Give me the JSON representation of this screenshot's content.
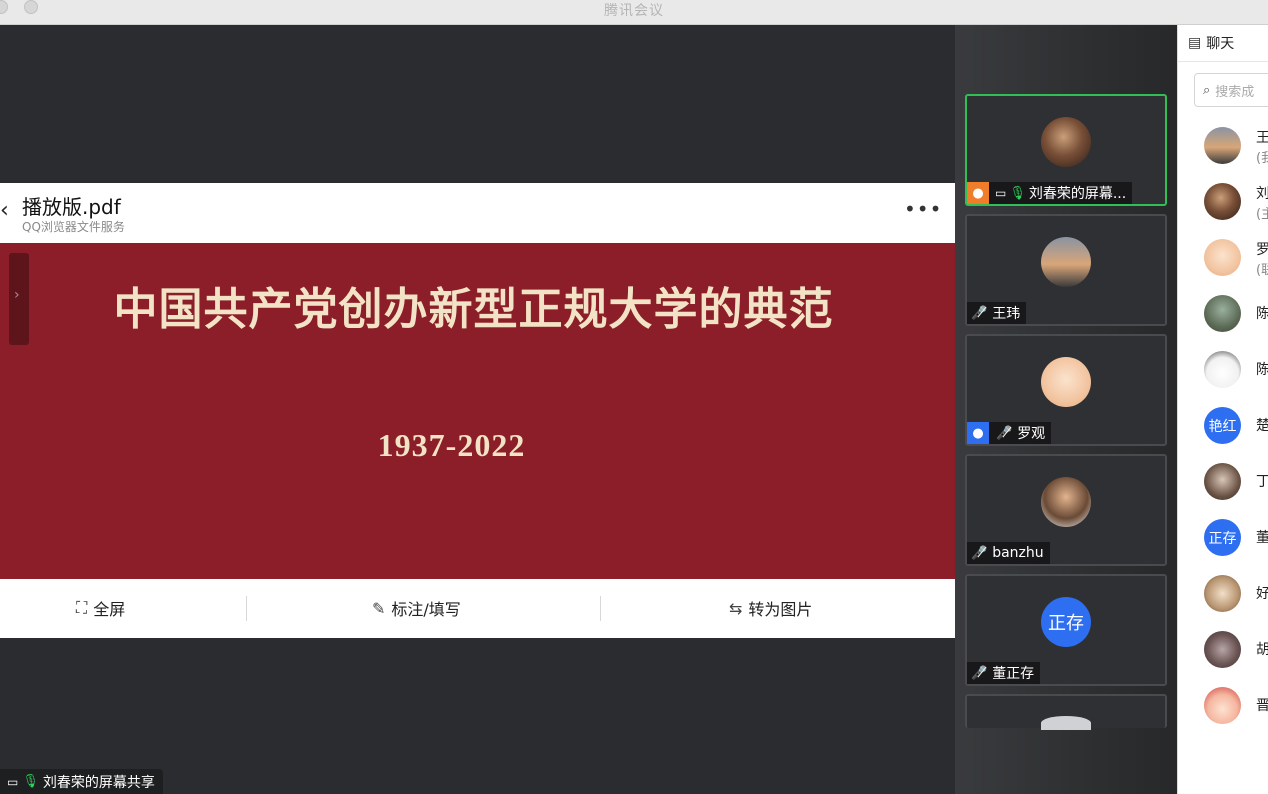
{
  "window": {
    "title": "腾讯会议"
  },
  "pdf": {
    "file_name": "播放版.pdf",
    "source": "QQ浏览器文件服务",
    "more_label": "•••",
    "slide": {
      "headline": "中国共产党创办新型正规大学的典范",
      "years": "1937-2022"
    },
    "toolbar": {
      "fullscreen": "全屏",
      "annotate": "标注/填写",
      "to_image": "转为图片"
    }
  },
  "share_tag": {
    "label": "刘春荣的屏幕共享"
  },
  "video_tiles": [
    {
      "name": "刘春荣的屏幕...",
      "active": true
    },
    {
      "name": "王玮"
    },
    {
      "name": "罗观"
    },
    {
      "name": "banzhu"
    },
    {
      "name": "董正存",
      "avatar_text": "正存"
    }
  ],
  "chat": {
    "title": "聊天",
    "search_placeholder": "搜索成",
    "participants": [
      {
        "name": "王",
        "sub": "(我"
      },
      {
        "name": "刘",
        "sub": "(主"
      },
      {
        "name": "罗",
        "sub": "(联"
      },
      {
        "name": "陈"
      },
      {
        "name": "陈"
      },
      {
        "name": "楚",
        "avatar_text": "艳红"
      },
      {
        "name": "丁"
      },
      {
        "name": "董",
        "avatar_text": "正存"
      },
      {
        "name": "好"
      },
      {
        "name": "胡"
      },
      {
        "name": "晋"
      }
    ]
  },
  "colors": {
    "accent_green": "#2fbf56",
    "slide_red": "#8b1e28",
    "avatar_blue": "#2d6ff0"
  }
}
